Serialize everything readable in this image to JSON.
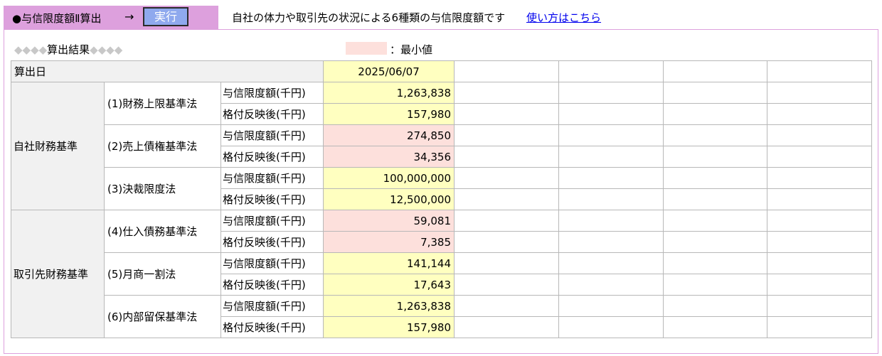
{
  "header": {
    "title": "●与信限度額Ⅱ算出",
    "arrow": "→",
    "execute_label": "実行",
    "description": "自社の体力や取引先の状況による6種類の与信限度額です",
    "howto_link": "使い方はこちら"
  },
  "result": {
    "heading_prefix": "◆◆◆◆",
    "heading_label": "算出結果",
    "heading_suffix": "◆◆◆◆",
    "legend_label": "：最小値",
    "legend_color": "#fde0dc",
    "highlight_color": "#ffffc0"
  },
  "table": {
    "date_label": "算出日",
    "date_value": "2025/06/07",
    "item_labels": {
      "limit": "与信限度額(千円)",
      "rated": "格付反映後(千円)"
    },
    "groups": [
      {
        "name": "自社財務基準",
        "methods": [
          {
            "name": "(1)財務上限基準法",
            "limit": "1,263,838",
            "rated": "157,980",
            "is_min": false
          },
          {
            "name": "(2)売上債権基準法",
            "limit": "274,850",
            "rated": "34,356",
            "is_min": true
          },
          {
            "name": "(3)決裁限度法",
            "limit": "100,000,000",
            "rated": "12,500,000",
            "is_min": false
          }
        ]
      },
      {
        "name": "取引先財務基準",
        "methods": [
          {
            "name": "(4)仕入債務基準法",
            "limit": "59,081",
            "rated": "7,385",
            "is_min": true
          },
          {
            "name": "(5)月商一割法",
            "limit": "141,144",
            "rated": "17,643",
            "is_min": false
          },
          {
            "name": "(6)内部留保基準法",
            "limit": "1,263,838",
            "rated": "157,980",
            "is_min": false
          }
        ]
      }
    ]
  }
}
